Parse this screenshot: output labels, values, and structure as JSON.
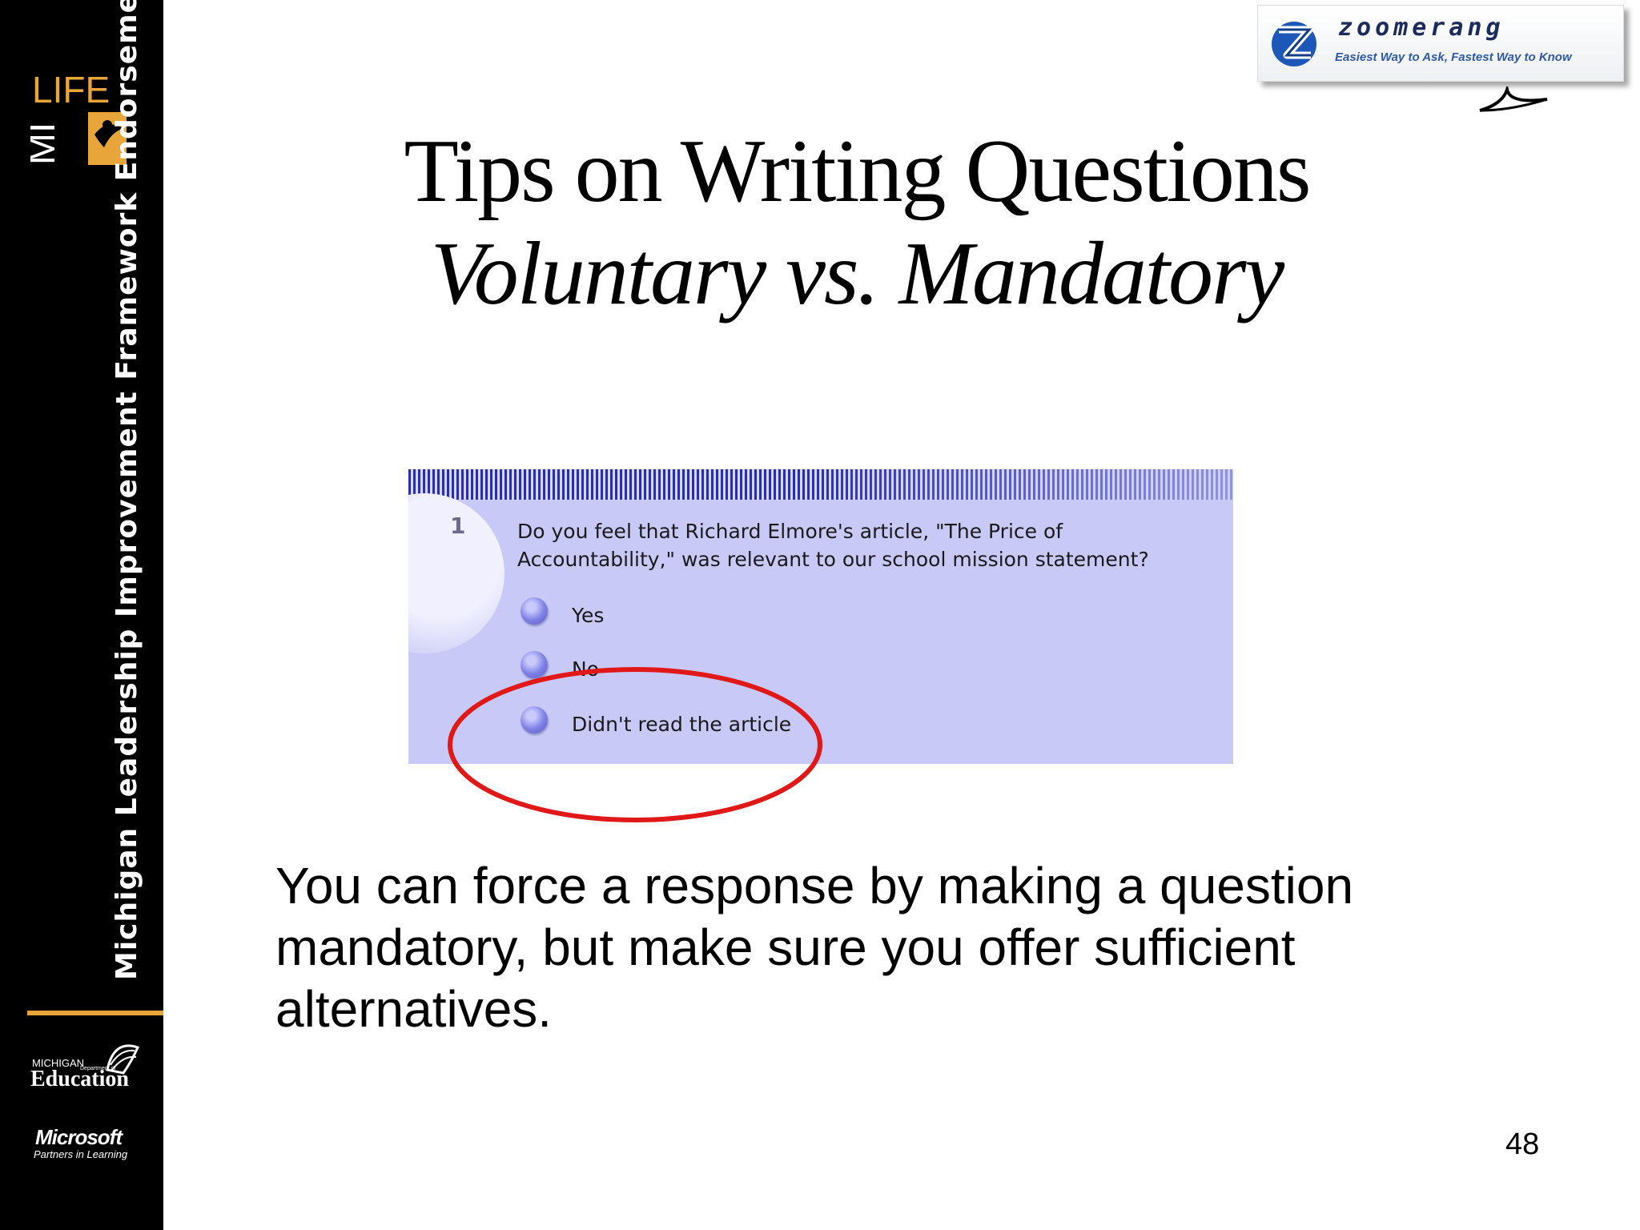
{
  "sidebar": {
    "life_logo_text": "LIFE",
    "mi_text": "MI",
    "vertical_title": "Michigan Leadership Improvement Framework Endorsement",
    "mde_small": "MICHIGAN",
    "mde_tiny": "Department of",
    "mde_big": "Education",
    "ms_logo": "Microsoft",
    "ms_tagline": "Partners in Learning"
  },
  "zoomerang": {
    "name": "zoomerang",
    "tagline": "Easiest Way to Ask, Fastest Way to Know"
  },
  "title": {
    "line1": "Tips on Writing Questions",
    "line2": "Voluntary vs. Mandatory"
  },
  "survey": {
    "question_number": "1",
    "question_text": "Do you feel that Richard Elmore's article, \"The Price of Accountability,\" was relevant to our school mission statement?",
    "options": [
      "Yes",
      "No",
      "Didn't read the article"
    ]
  },
  "body_text": "You can force a response by making a question mandatory, but make sure you offer sufficient alternatives.",
  "page_number": "48",
  "colors": {
    "sidebar_bg": "#000000",
    "accent_orange": "#e8a53a",
    "survey_bg": "#c8c9f6",
    "highlight_red": "#e01818"
  }
}
